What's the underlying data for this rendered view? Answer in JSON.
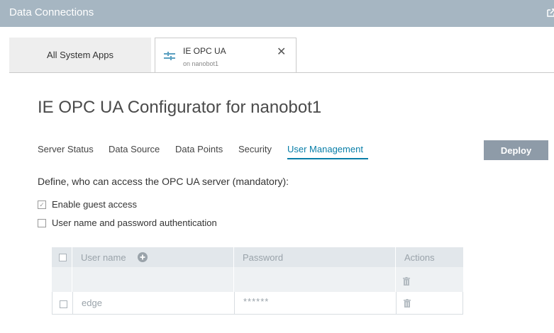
{
  "window": {
    "title": "Data Connections"
  },
  "tabs": {
    "all_apps": "All System Apps",
    "opc": {
      "name": "IE OPC UA",
      "subtitle": "on nanobot1",
      "close": "✕"
    }
  },
  "page": {
    "title": "IE OPC UA Configurator for nanobot1"
  },
  "subnav": [
    "Server Status",
    "Data Source",
    "Data Points",
    "Security",
    "User Management"
  ],
  "subnav_active": "User Management",
  "deploy_label": "Deploy",
  "access": {
    "heading": "Define, who can access the OPC UA server (mandatory):",
    "guest": {
      "label": "Enable guest access",
      "checked": true
    },
    "userpass": {
      "label": "User name and password authentication",
      "checked": false
    }
  },
  "table": {
    "headers": {
      "username": "User name",
      "password": "Password",
      "actions": "Actions"
    },
    "rows": [
      {
        "username": "",
        "password": ""
      },
      {
        "username": "edge",
        "password": "******"
      }
    ]
  },
  "colors": {
    "accent": "#087ea8",
    "titlebar": "#a6b6c2",
    "deploy": "#8e9ba8"
  }
}
